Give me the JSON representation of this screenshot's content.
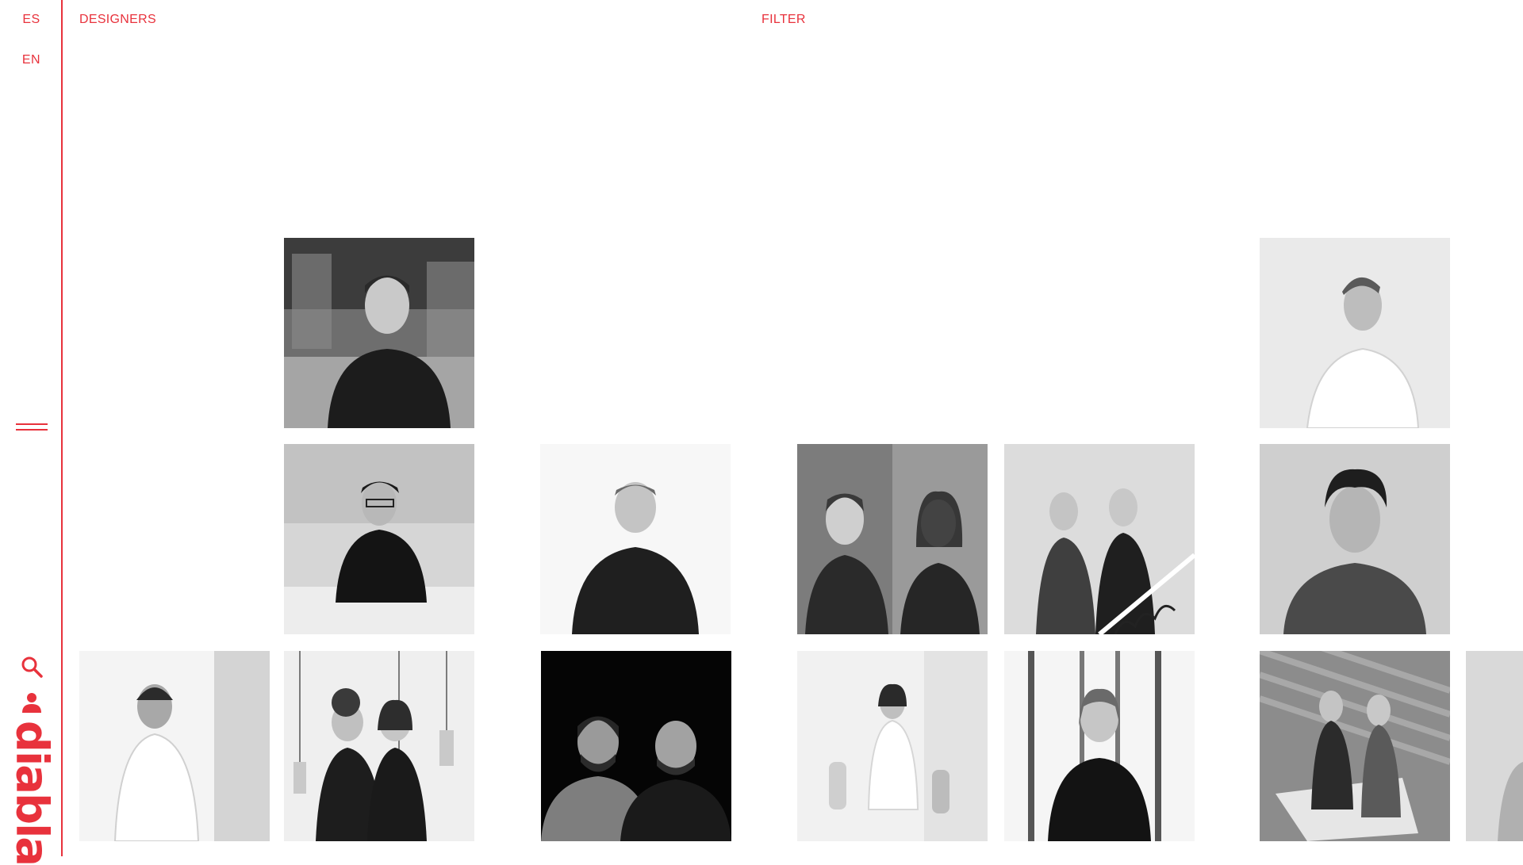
{
  "sidebar": {
    "languages": [
      "ES",
      "EN"
    ],
    "menu_icon": "hamburger-icon",
    "search_icon": "search-icon",
    "user_icon": "user-icon",
    "logo_text": "diabla"
  },
  "header": {
    "section_label": "DESIGNERS",
    "filter_label": "FILTER"
  },
  "colors": {
    "accent": "#e8323c"
  },
  "designers_grid": {
    "items": [
      {
        "name": "designer-portrait-1",
        "photo": "man in dark t-shirt, workshop background"
      },
      {
        "name": "designer-portrait-2",
        "photo": "man in white shirt looking sideways, light wall"
      },
      {
        "name": "designer-portrait-3",
        "photo": "man with glasses in black shirt leaning on railing"
      },
      {
        "name": "designer-portrait-4",
        "photo": "man in dark sweater, white background"
      },
      {
        "name": "designer-portrait-5",
        "photo": "man and woman split portrait"
      },
      {
        "name": "designer-portrait-6",
        "photo": "man and woman on staircase"
      },
      {
        "name": "designer-portrait-7",
        "photo": "curly-haired man in dark t-shirt"
      },
      {
        "name": "designer-portrait-8",
        "photo": "man with beanie leaning on wall"
      },
      {
        "name": "designer-portrait-9",
        "photo": "two women with pendant lamps"
      },
      {
        "name": "designer-portrait-10",
        "photo": "two bearded men on black background"
      },
      {
        "name": "designer-portrait-11",
        "photo": "woman seated in bright room with vases"
      },
      {
        "name": "designer-portrait-12",
        "photo": "woman in black top, window frames"
      },
      {
        "name": "designer-portrait-13",
        "photo": "two women seated on a chair, patterned wall"
      },
      {
        "name": "designer-portrait-14",
        "photo": "partially visible portrait"
      }
    ]
  }
}
